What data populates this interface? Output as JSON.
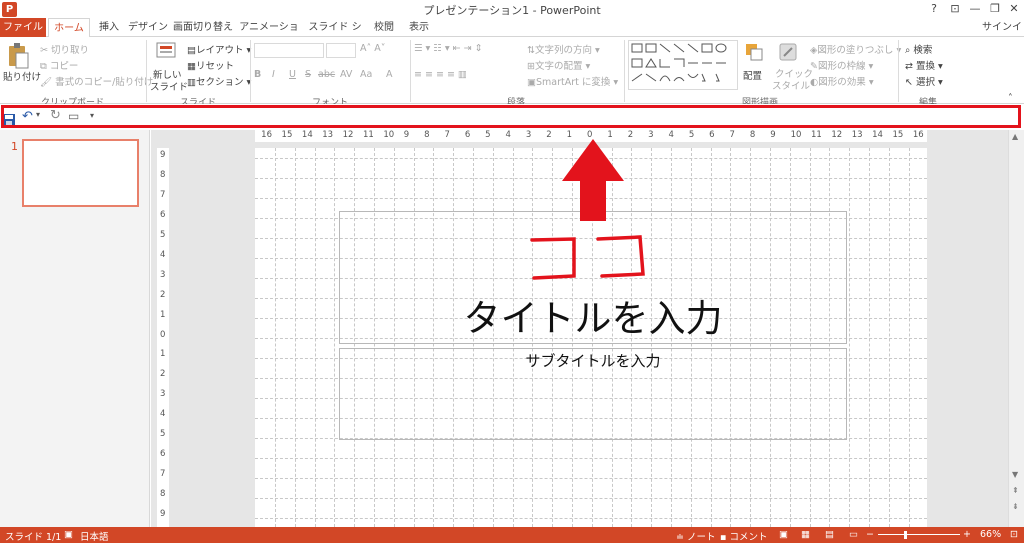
{
  "app": {
    "icon_letter": "P",
    "title": "プレゼンテーション1 - PowerPoint"
  },
  "window_controls": {
    "help": "?",
    "ribbon_display": "⊡",
    "minimize": "—",
    "restore": "❐",
    "close": "✕",
    "signin": "サインイン"
  },
  "tabs": [
    {
      "label": "ファイル"
    },
    {
      "label": "ホーム"
    },
    {
      "label": "挿入"
    },
    {
      "label": "デザイン"
    },
    {
      "label": "画面切り替え"
    },
    {
      "label": "アニメーション"
    },
    {
      "label": "スライド ショー"
    },
    {
      "label": "校閲"
    },
    {
      "label": "表示"
    }
  ],
  "ribbon": {
    "clipboard": {
      "paste": "貼り付け",
      "cut": "切り取り",
      "copy": "コピー",
      "format_painter": "書式のコピー/貼り付け",
      "group": "クリップボード"
    },
    "slides": {
      "new_slide_1": "新しい",
      "new_slide_2": "スライド",
      "layout": "レイアウト",
      "reset": "リセット",
      "section": "セクション",
      "group": "スライド"
    },
    "font": {
      "bold": "B",
      "italic": "I",
      "underline": "U",
      "strike": "S",
      "shadow": "abc",
      "spacing": "AV",
      "case": "Aa",
      "color": "A",
      "group": "フォント"
    },
    "paragraph": {
      "text_direction": "文字列の方向",
      "align_text": "文字の配置",
      "smartart": "SmartArt に変換",
      "group": "段落"
    },
    "drawing": {
      "arrange": "配置",
      "quick_styles_1": "クイック",
      "quick_styles_2": "スタイル",
      "fill": "図形の塗りつぶし",
      "outline": "図形の枠線",
      "effects": "図形の効果",
      "group": "図形描画"
    },
    "editing": {
      "find": "検索",
      "replace": "置換",
      "select": "選択",
      "group": "編集"
    }
  },
  "thumbnails": [
    {
      "number": "1"
    }
  ],
  "ruler": {
    "horizontal": [
      "16",
      "15",
      "14",
      "13",
      "12",
      "11",
      "10",
      "9",
      "8",
      "7",
      "6",
      "5",
      "4",
      "3",
      "2",
      "1",
      "0",
      "1",
      "2",
      "3",
      "4",
      "5",
      "6",
      "7",
      "8",
      "9",
      "10",
      "11",
      "12",
      "13",
      "14",
      "15",
      "16"
    ],
    "vertical": [
      "9",
      "8",
      "7",
      "6",
      "5",
      "4",
      "3",
      "2",
      "1",
      "0",
      "1",
      "2",
      "3",
      "4",
      "5",
      "6",
      "7",
      "8",
      "9"
    ]
  },
  "slide": {
    "annotation": "ココ",
    "title_placeholder": "タイトルを入力",
    "subtitle_placeholder": "サブタイトルを入力"
  },
  "status": {
    "slide_counter": "スライド 1/1",
    "language": "日本語",
    "notes": "ノート",
    "comments": "コメント",
    "zoom": "66%"
  },
  "colors": {
    "accent": "#d24726",
    "highlight": "#e3131c"
  }
}
